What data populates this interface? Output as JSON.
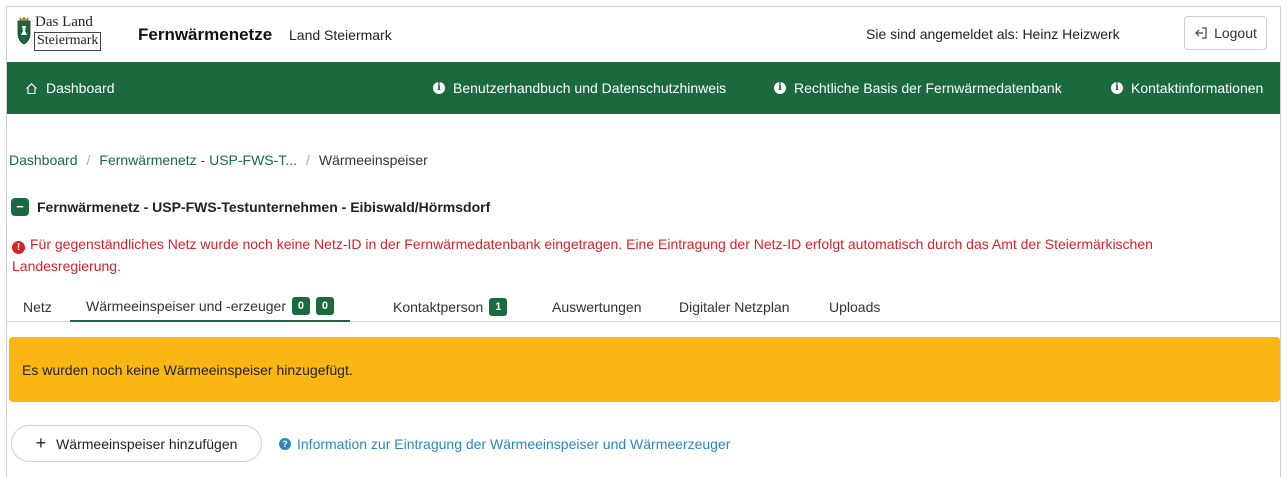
{
  "header": {
    "logo_line1": "Das Land",
    "logo_line2": "Steiermark",
    "app_title": "Fernwärmenetze",
    "app_subtitle": "Land Steiermark",
    "login_prefix": "Sie sind angemeldet als:",
    "user_name": "Heinz Heizwerk",
    "logout_label": "Logout"
  },
  "nav": {
    "dashboard": "Dashboard",
    "manual": "Benutzerhandbuch und Datenschutzhinweis",
    "legal": "Rechtliche Basis der Fernwärmedatenbank",
    "contact": "Kontaktinformationen"
  },
  "breadcrumb": {
    "items": [
      "Dashboard",
      "Fernwärmenetz - USP-FWS-T...",
      "Wärmeeinspeiser"
    ]
  },
  "network": {
    "title": "Fernwärmenetz - USP-FWS-Testunternehmen - Eibiswald/Hörmsdorf",
    "collapse_symbol": "−"
  },
  "warning": {
    "text": "Für gegenständliches Netz wurde noch keine Netz-ID in der Fernwärmedatenbank eingetragen. Eine Eintragung der Netz-ID erfolgt automatisch durch das Amt der Steiermärkischen Landesregierung."
  },
  "tabs": [
    {
      "label": "Netz"
    },
    {
      "label": "Wärmeeinspeiser und -erzeuger",
      "badge1": "0",
      "badge2": "0"
    },
    {
      "label": "Kontaktperson",
      "badge1": "1"
    },
    {
      "label": "Auswertungen"
    },
    {
      "label": "Digitaler Netzplan"
    },
    {
      "label": "Uploads"
    }
  ],
  "alert": {
    "text": "Es wurden noch keine Wärmeeinspeiser hinzugefügt."
  },
  "actions": {
    "add_label": "Wärmeeinspeiser hinzufügen",
    "info_link": "Information zur Eintragung der Wärmeeinspeiser und Wärmeerzeuger"
  },
  "colors": {
    "brand_green": "#1b6a3f",
    "warning_red": "#d6232c",
    "alert_yellow": "#fbb614",
    "link_blue": "#2e86c1"
  }
}
